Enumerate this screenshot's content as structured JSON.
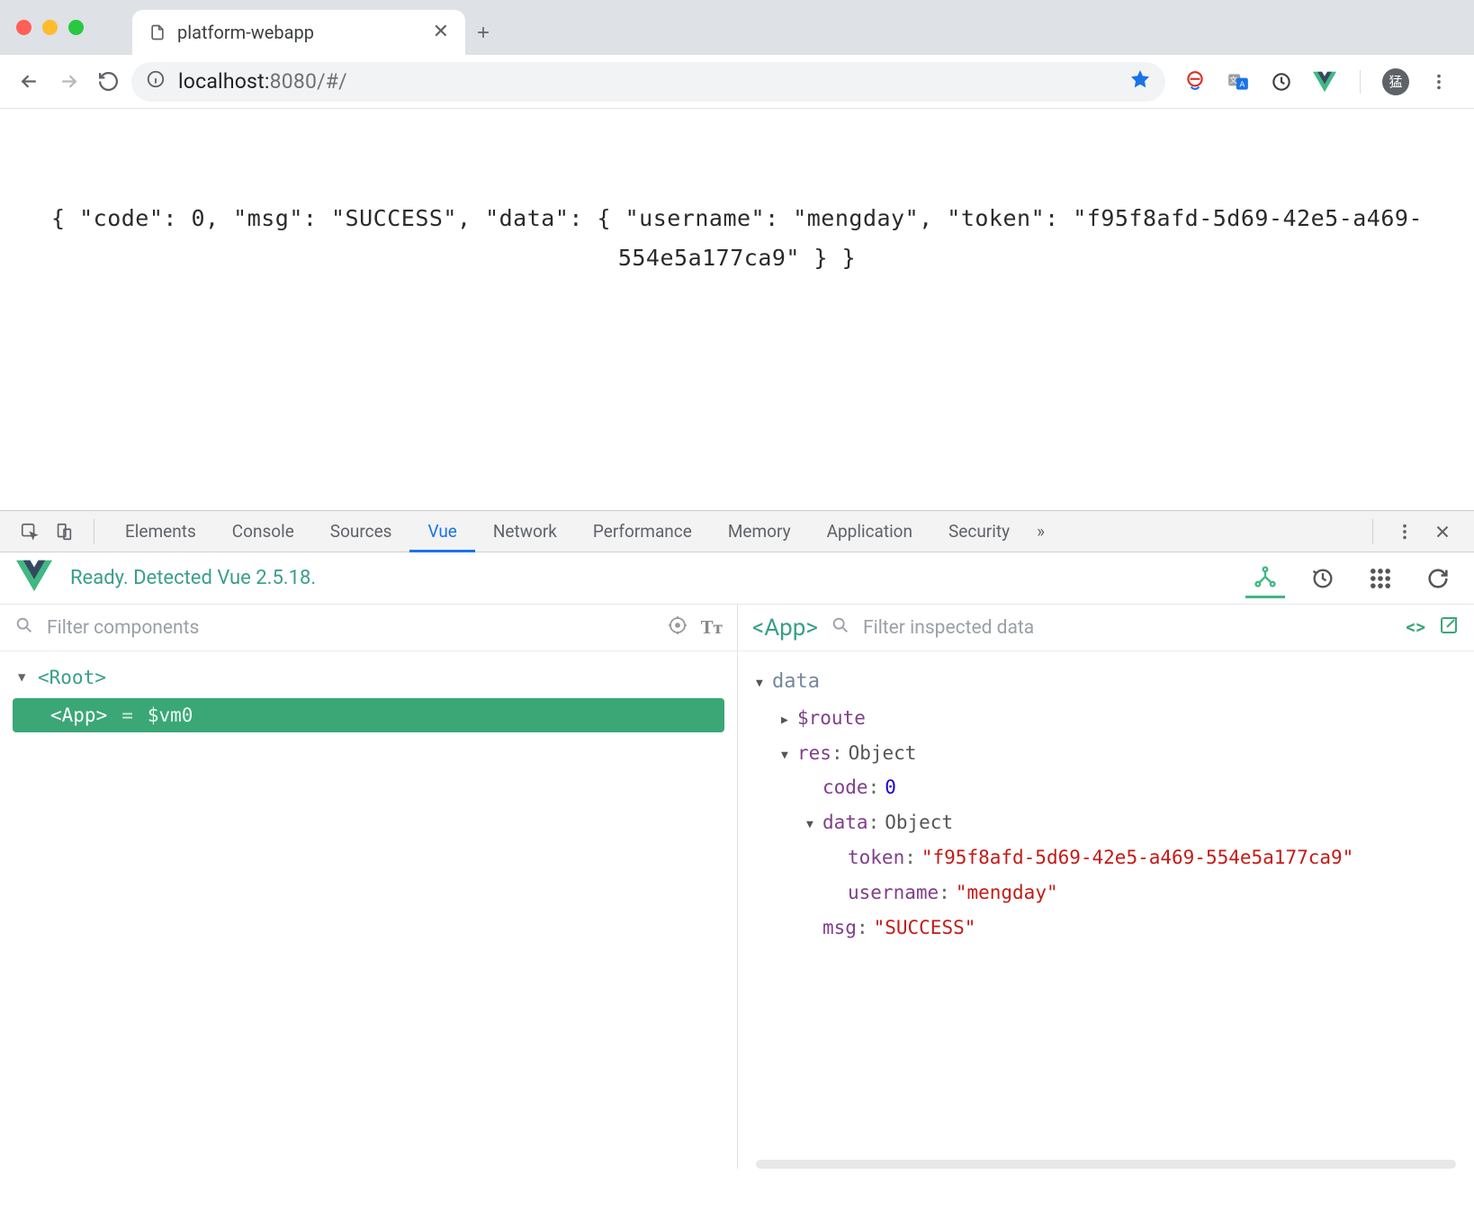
{
  "browser": {
    "tab_title": "platform-webapp",
    "url_host": "localhost:",
    "url_port_path": "8080/#/"
  },
  "page": {
    "body_text": "{ \"code\": 0, \"msg\": \"SUCCESS\", \"data\": { \"username\": \"mengday\", \"token\": \"f95f8afd-5d69-42e5-a469-554e5a177ca9\" } }"
  },
  "devtools": {
    "tabs": [
      "Elements",
      "Console",
      "Sources",
      "Vue",
      "Network",
      "Performance",
      "Memory",
      "Application",
      "Security"
    ],
    "active_tab": "Vue"
  },
  "vuebar": {
    "status": "Ready. Detected Vue 2.5.18."
  },
  "left": {
    "filter_placeholder": "Filter components",
    "root_label": "<Root>",
    "selected_label": "<App>",
    "selected_eq": "=",
    "selected_var": "$vm0"
  },
  "right": {
    "component_label": "<App>",
    "filter_placeholder": "Filter inspected data",
    "section": "data",
    "rows": {
      "route_key": "$route",
      "res_key": "res",
      "res_type": "Object",
      "code_key": "code",
      "code_val": "0",
      "data_key": "data",
      "data_type": "Object",
      "token_key": "token",
      "token_val": "\"f95f8afd-5d69-42e5-a469-554e5a177ca9\"",
      "username_key": "username",
      "username_val": "\"mengday\"",
      "msg_key": "msg",
      "msg_val": "\"SUCCESS\""
    }
  },
  "avatar_initial": "猛"
}
